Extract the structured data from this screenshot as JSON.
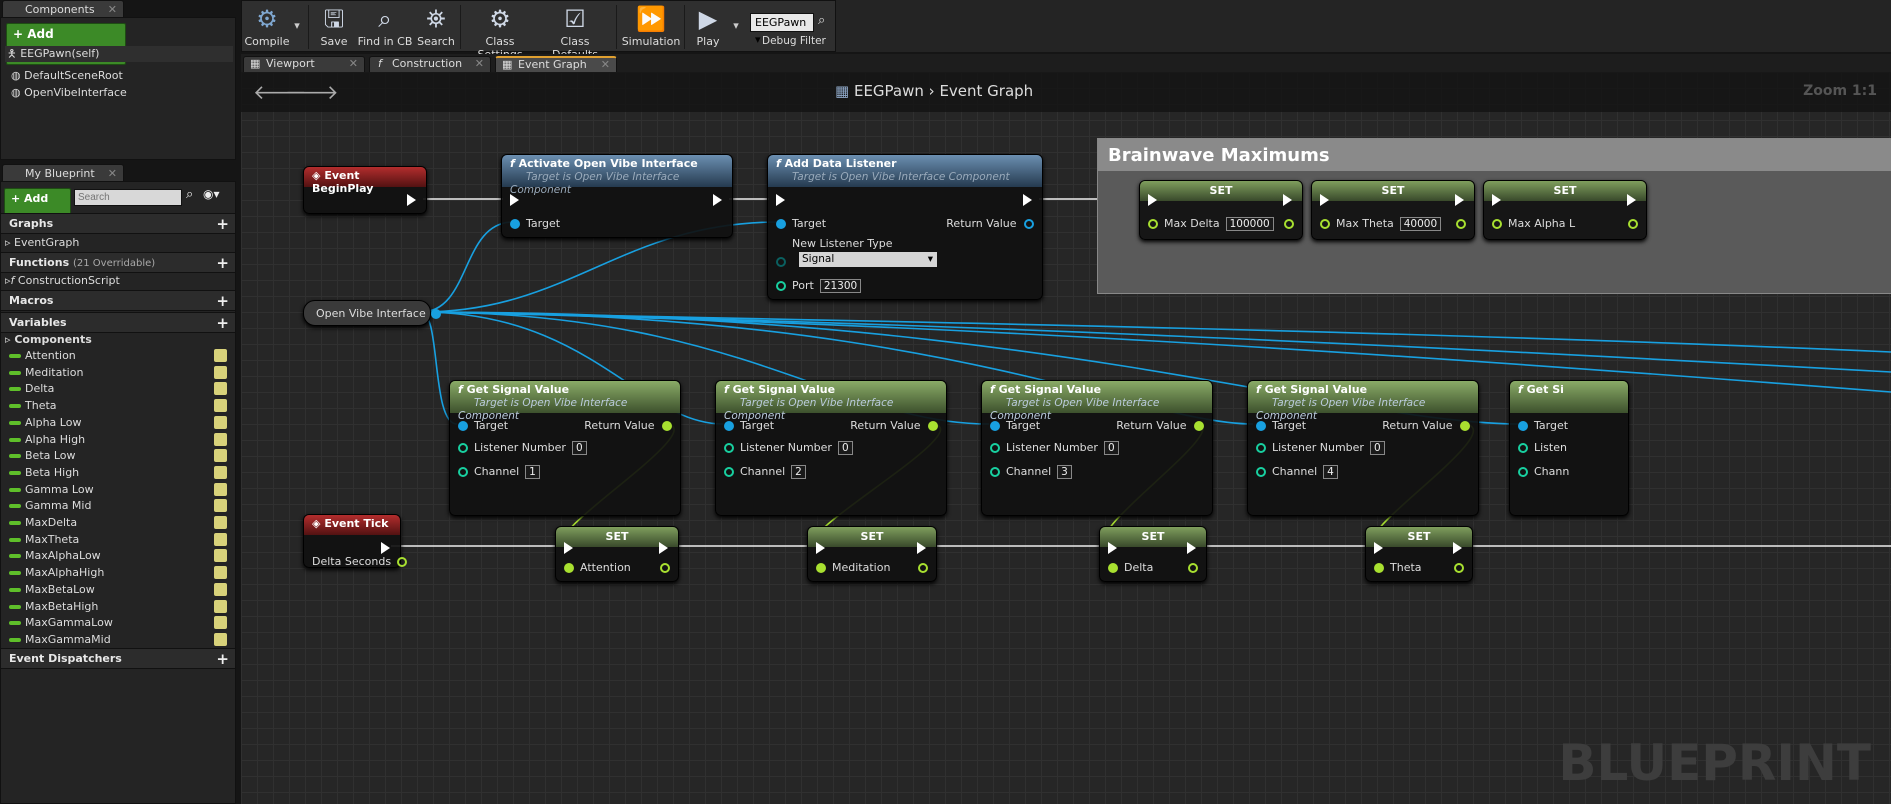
{
  "components_panel": {
    "tab_label": "Components",
    "add_component_label": "Add Component",
    "self_label": "EEGPawn(self)",
    "items": [
      "DefaultSceneRoot",
      "OpenVibeInterface"
    ]
  },
  "my_blueprint": {
    "tab_label": "My Blueprint",
    "add_new_label": "Add New",
    "search_placeholder": "Search",
    "graphs_label": "Graphs",
    "event_graph_label": "EventGraph",
    "functions_label": "Functions",
    "functions_note": "(21 Overridable)",
    "construction_script_label": "ConstructionScript",
    "macros_label": "Macros",
    "variables_label": "Variables",
    "components_label": "Components",
    "variables": [
      "Attention",
      "Meditation",
      "Delta",
      "Theta",
      "Alpha Low",
      "Alpha High",
      "Beta Low",
      "Beta High",
      "Gamma Low",
      "Gamma Mid",
      "MaxDelta",
      "MaxTheta",
      "MaxAlphaLow",
      "MaxAlphaHigh",
      "MaxBetaLow",
      "MaxBetaHigh",
      "MaxGammaLow",
      "MaxGammaMid"
    ],
    "event_dispatchers_label": "Event Dispatchers"
  },
  "toolbar": {
    "compile": "Compile",
    "save": "Save",
    "find_in_cb": "Find in CB",
    "search": "Search",
    "class_settings": "Class Settings",
    "class_defaults": "Class Defaults",
    "simulation": "Simulation",
    "play": "Play",
    "debug_filter_value": "EEGPawn",
    "debug_filter_label": "Debug Filter"
  },
  "editor_tabs": [
    "Viewport",
    "Construction Script",
    "Event Graph"
  ],
  "graph": {
    "breadcrumb_root": "EEGPawn",
    "breadcrumb_current": "Event Graph",
    "zoom": "Zoom 1:1",
    "watermark": "BLUEPRINT",
    "comment_title": "Brainwave Maximums",
    "nodes": {
      "begin_play": "Event BeginPlay",
      "activate_title": "Activate Open Vibe Interface",
      "activate_sub": "Target is Open Vibe Interface Component",
      "target": "Target",
      "add_listener_title": "Add Data Listener",
      "add_listener_sub": "Target is Open Vibe Interface Component",
      "return_value": "Return Value",
      "new_listener_type": "New Listener Type",
      "listener_type_value": "Signal",
      "port_label": "Port",
      "port_value": "21300",
      "ovi_var": "Open Vibe Interface",
      "set": "SET",
      "max_sets": [
        {
          "label": "Max Delta",
          "value": "100000"
        },
        {
          "label": "Max Theta",
          "value": "40000"
        },
        {
          "label": "Max Alpha L",
          "value": ""
        }
      ],
      "get_signal_title": "Get Signal Value",
      "get_signal_sub": "Target is Open Vibe Interface Component",
      "listener_number": "Listener Number",
      "channel": "Channel",
      "signals": [
        {
          "listener": "0",
          "channel": "1"
        },
        {
          "listener": "0",
          "channel": "2"
        },
        {
          "listener": "0",
          "channel": "3"
        },
        {
          "listener": "0",
          "channel": "4"
        }
      ],
      "partial_get_title": "Get Si",
      "partial_listener": "Listen",
      "partial_channel": "Chann",
      "event_tick": "Event Tick",
      "delta_seconds": "Delta Seconds",
      "tick_sets": [
        "Attention",
        "Meditation",
        "Delta",
        "Theta"
      ]
    }
  }
}
